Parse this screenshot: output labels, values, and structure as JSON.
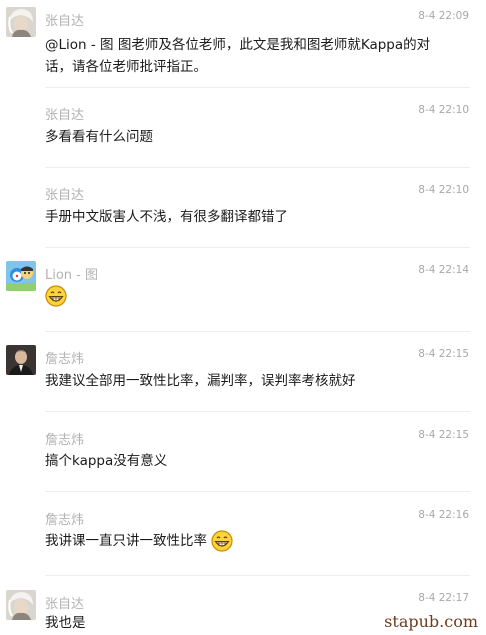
{
  "messages": [
    {
      "sender": "张自达",
      "time": "8-4 22:09",
      "text": "@Lion - 图 图老师及各位老师，此文是我和图老师就Kappa的对话，请各位老师批评指正。",
      "avatar": "white-hair-avatar"
    },
    {
      "sender": "张自达",
      "time": "8-4 22:10",
      "text": "多看看有什么问题"
    },
    {
      "sender": "张自达",
      "time": "8-4 22:10",
      "text": "手册中文版害人不浅，有很多翻译都错了"
    },
    {
      "sender": "Lion - 图",
      "time": "8-4 22:14",
      "text": "",
      "emoji": "grin-emoji",
      "avatar": "cartoon-avatar"
    },
    {
      "sender": "詹志炜",
      "time": "8-4 22:15",
      "text": "我建议全部用一致性比率，漏判率，误判率考核就好",
      "avatar": "suit-man-avatar"
    },
    {
      "sender": "詹志炜",
      "time": "8-4 22:15",
      "text": "搞个kappa没有意义"
    },
    {
      "sender": "詹志炜",
      "time": "8-4 22:16",
      "text": "我讲课一直只讲一致性比率",
      "emoji": "grin-emoji"
    },
    {
      "sender": "张自达",
      "time": "8-4 22:17",
      "text": "我也是",
      "avatar": "white-hair-avatar"
    }
  ],
  "watermark": "stapub.com"
}
